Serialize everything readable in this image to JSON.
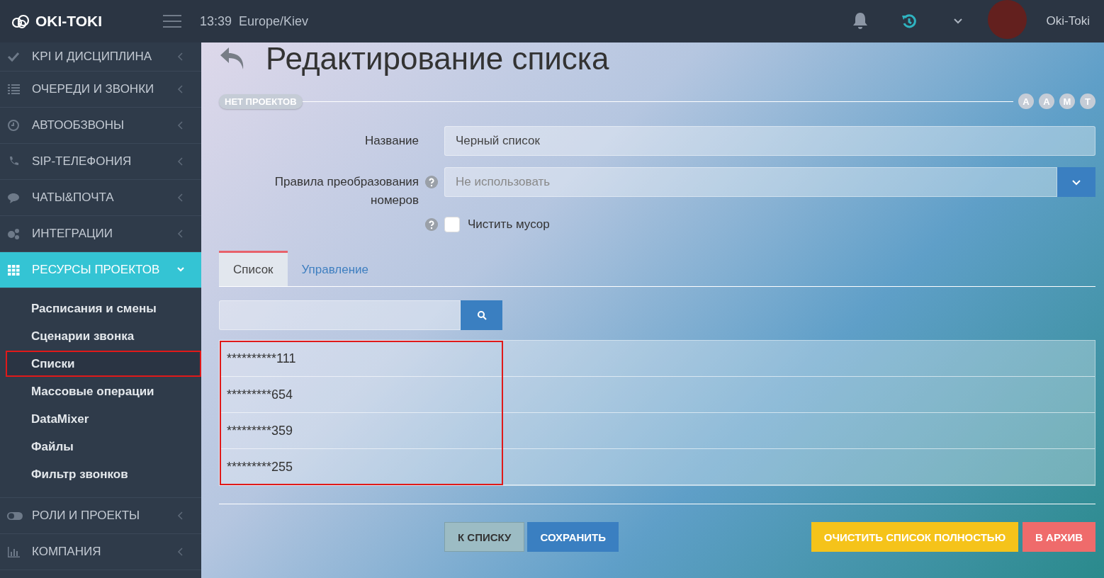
{
  "header": {
    "logo": "OKI-TOKI",
    "time": "13:39",
    "timezone": "Europe/Kiev",
    "user": "Oki-Toki"
  },
  "sidebar": {
    "items": [
      {
        "label": "KPI И ДИСЦИПЛИНА",
        "expanded": false
      },
      {
        "label": "ОЧЕРЕДИ И ЗВОНКИ",
        "expanded": false
      },
      {
        "label": "АВТООБЗВОНЫ",
        "expanded": false
      },
      {
        "label": "SIP-ТЕЛЕФОНИЯ",
        "expanded": false
      },
      {
        "label": "ЧАТЫ&ПОЧТА",
        "expanded": false
      },
      {
        "label": "ИНТЕГРАЦИИ",
        "expanded": false
      },
      {
        "label": "РЕСУРСЫ ПРОЕКТОВ",
        "expanded": true,
        "children": [
          {
            "label": "Расписания и смены",
            "highlighted": false
          },
          {
            "label": "Сценарии звонка",
            "highlighted": false
          },
          {
            "label": "Списки",
            "highlighted": true
          },
          {
            "label": "Массовые операции",
            "highlighted": false
          },
          {
            "label": "DataMixer",
            "highlighted": false
          },
          {
            "label": "Файлы",
            "highlighted": false
          },
          {
            "label": "Фильтр звонков",
            "highlighted": false
          }
        ]
      },
      {
        "label": "РОЛИ И ПРОЕКТЫ",
        "expanded": false
      },
      {
        "label": "КОМПАНИЯ",
        "expanded": false
      }
    ]
  },
  "page": {
    "title": "Редактирование списка",
    "project_tag": "НЕТ ПРОЕКТОВ",
    "user_badges": [
      "A",
      "A",
      "M",
      "T"
    ],
    "fields": [
      {
        "kind": "text",
        "label": "Название",
        "value": "Черный список"
      },
      {
        "kind": "select",
        "label": "Правила преобразования номеров",
        "placeholder": "Не использовать"
      },
      {
        "kind": "checkbox",
        "label": "Чистить мусор",
        "checked": false
      }
    ],
    "tabs": [
      {
        "label": "Список",
        "selected": true
      },
      {
        "label": "Управление",
        "selected": false
      }
    ],
    "list": {
      "highlighted": true,
      "rows": [
        "**********111",
        "*********654",
        "*********359",
        "*********255"
      ]
    },
    "buttons": [
      {
        "label": "К СПИСКУ",
        "kind": "default"
      },
      {
        "label": "СОХРАНИТЬ",
        "kind": "primary"
      },
      {
        "label": "ОЧИСТИТЬ СПИСОК ПОЛНОСТЬЮ",
        "kind": "warning"
      },
      {
        "label": "В АРХИВ",
        "kind": "danger"
      }
    ]
  }
}
